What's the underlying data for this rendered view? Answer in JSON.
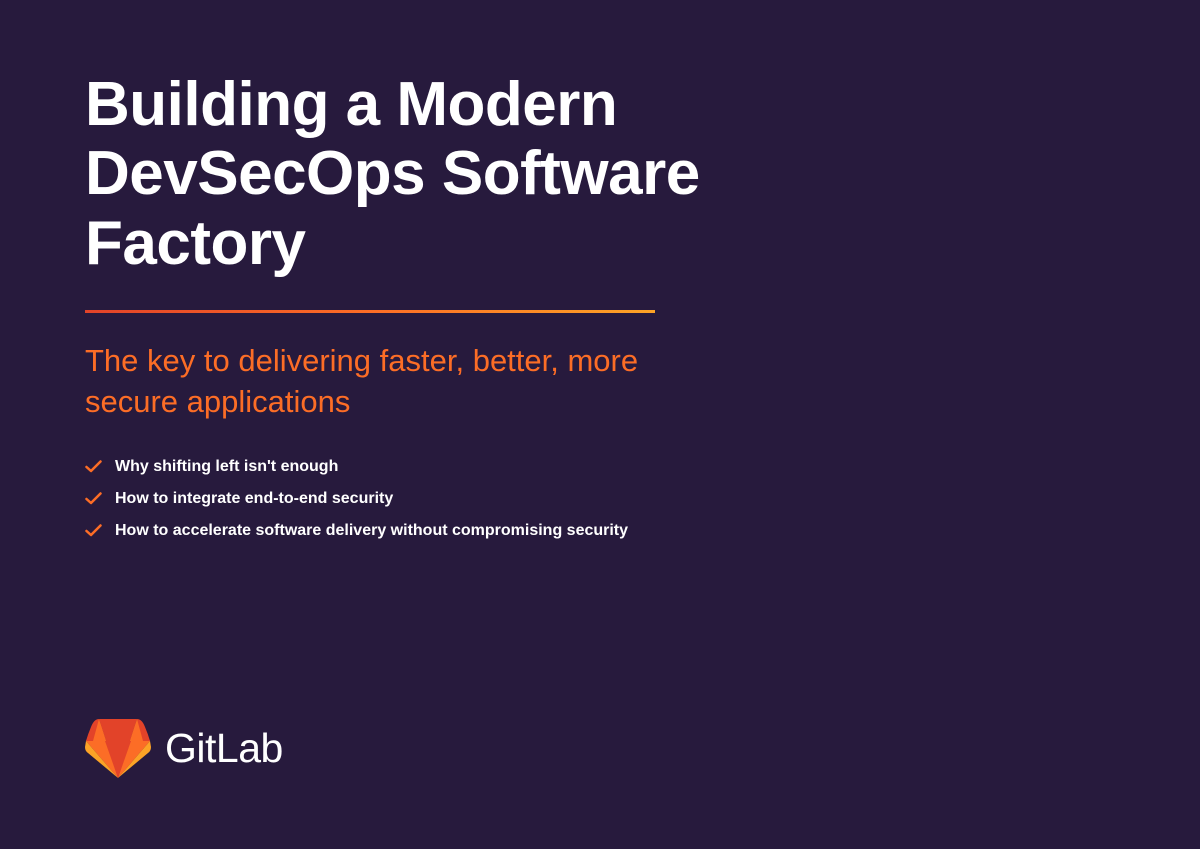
{
  "title": "Building a Modern DevSecOps Software Factory",
  "subtitle": "The key to delivering faster, better, more secure applications",
  "bullets": [
    "Why shifting left isn't enough",
    "How to integrate end-to-end security",
    "How to accelerate software delivery without compromising security"
  ],
  "logo": {
    "name": "GitLab"
  },
  "colors": {
    "background": "#271a3d",
    "accent": "#fc6d26",
    "white": "#ffffff"
  }
}
